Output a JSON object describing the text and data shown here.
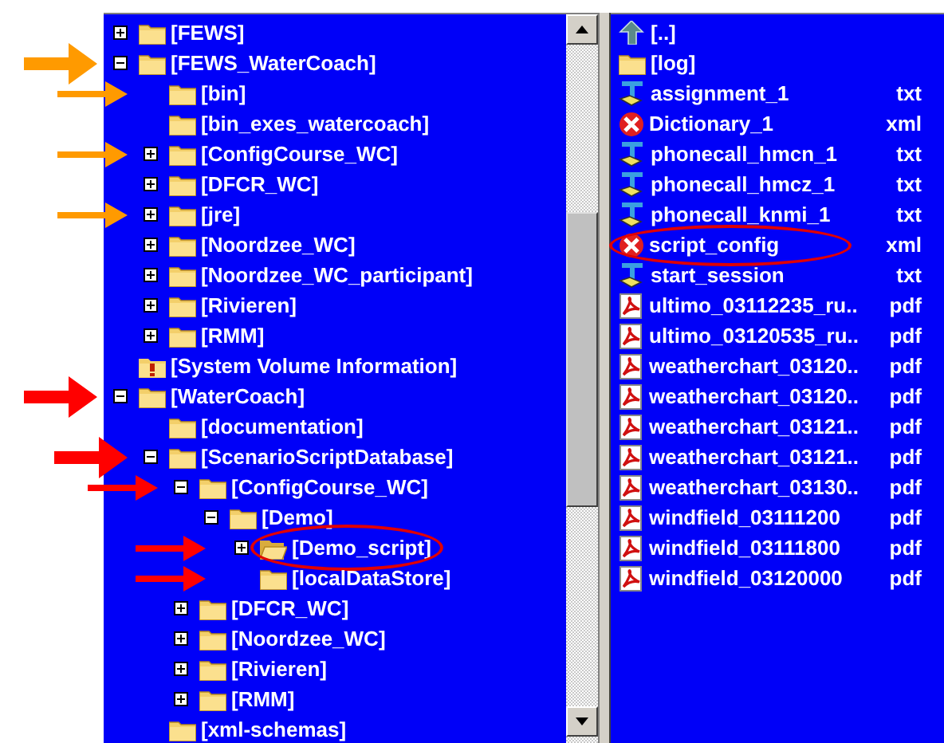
{
  "tree": [
    {
      "label": "[FEWS]",
      "kind": "folder",
      "expanded": false
    },
    {
      "label": "[FEWS_WaterCoach]",
      "kind": "folder",
      "expanded": true,
      "arrow": {
        "color": "#ff9a00",
        "kind": "large"
      },
      "children": [
        {
          "label": "[bin]",
          "kind": "folder",
          "arrow": {
            "color": "#ff9a00",
            "kind": "small"
          }
        },
        {
          "label": "[bin_exes_watercoach]",
          "kind": "folder"
        },
        {
          "label": "[ConfigCourse_WC]",
          "kind": "folder",
          "expanded": false,
          "arrow": {
            "color": "#ff9a00",
            "kind": "small"
          }
        },
        {
          "label": "[DFCR_WC]",
          "kind": "folder",
          "expanded": false
        },
        {
          "label": "[jre]",
          "kind": "folder",
          "expanded": false,
          "arrow": {
            "color": "#ff9a00",
            "kind": "small"
          }
        },
        {
          "label": "[Noordzee_WC]",
          "kind": "folder",
          "expanded": false
        },
        {
          "label": "[Noordzee_WC_participant]",
          "kind": "folder",
          "expanded": false
        },
        {
          "label": "[Rivieren]",
          "kind": "folder",
          "expanded": false
        },
        {
          "label": "[RMM]",
          "kind": "folder",
          "expanded": false
        }
      ]
    },
    {
      "label": "[System Volume Information]",
      "kind": "warning-folder"
    },
    {
      "label": "[WaterCoach]",
      "kind": "folder",
      "expanded": true,
      "arrow": {
        "color": "#ff0000",
        "kind": "large"
      },
      "children": [
        {
          "label": "[documentation]",
          "kind": "folder"
        },
        {
          "label": "[ScenarioScriptDatabase]",
          "kind": "folder",
          "expanded": true,
          "arrow": {
            "color": "#ff0000",
            "kind": "large"
          },
          "children": [
            {
              "label": "[ConfigCourse_WC]",
              "kind": "folder",
              "expanded": true,
              "arrow": {
                "color": "#ff0000",
                "kind": "small"
              },
              "children": [
                {
                  "label": "[Demo]",
                  "kind": "folder",
                  "expanded": true,
                  "children": [
                    {
                      "label": "[Demo_script]",
                      "kind": "open-folder",
                      "expanded": false,
                      "circled": true,
                      "arrow": {
                        "color": "#ff0000",
                        "kind": "small"
                      }
                    },
                    {
                      "label": "[localDataStore]",
                      "kind": "folder",
                      "arrow": {
                        "color": "#ff0000",
                        "kind": "small"
                      }
                    }
                  ]
                }
              ]
            },
            {
              "label": "[DFCR_WC]",
              "kind": "folder",
              "expanded": false
            },
            {
              "label": "[Noordzee_WC]",
              "kind": "folder",
              "expanded": false
            },
            {
              "label": "[Rivieren]",
              "kind": "folder",
              "expanded": false
            },
            {
              "label": "[RMM]",
              "kind": "folder",
              "expanded": false
            }
          ]
        },
        {
          "label": "[xml-schemas]",
          "kind": "folder"
        }
      ]
    }
  ],
  "files": [
    {
      "name": "[..]",
      "kind": "up"
    },
    {
      "name": "[log]",
      "kind": "folder"
    },
    {
      "name": "assignment_1",
      "ext": "txt",
      "kind": "text"
    },
    {
      "name": "Dictionary_1",
      "ext": "xml",
      "kind": "xml"
    },
    {
      "name": "phonecall_hmcn_1",
      "ext": "txt",
      "kind": "text"
    },
    {
      "name": "phonecall_hmcz_1",
      "ext": "txt",
      "kind": "text"
    },
    {
      "name": "phonecall_knmi_1",
      "ext": "txt",
      "kind": "text"
    },
    {
      "name": "script_config",
      "ext": "xml",
      "kind": "xml",
      "circled": true
    },
    {
      "name": "start_session",
      "ext": "txt",
      "kind": "text"
    },
    {
      "name": "ultimo_03112235_ru..",
      "ext": "pdf",
      "kind": "pdf"
    },
    {
      "name": "ultimo_03120535_ru..",
      "ext": "pdf",
      "kind": "pdf"
    },
    {
      "name": "weatherchart_03120..",
      "ext": "pdf",
      "kind": "pdf"
    },
    {
      "name": "weatherchart_03120..",
      "ext": "pdf",
      "kind": "pdf"
    },
    {
      "name": "weatherchart_03121..",
      "ext": "pdf",
      "kind": "pdf"
    },
    {
      "name": "weatherchart_03121..",
      "ext": "pdf",
      "kind": "pdf"
    },
    {
      "name": "weatherchart_03130..",
      "ext": "pdf",
      "kind": "pdf"
    },
    {
      "name": "windfield_03111200",
      "ext": "pdf",
      "kind": "pdf"
    },
    {
      "name": "windfield_03111800",
      "ext": "pdf",
      "kind": "pdf"
    },
    {
      "name": "windfield_03120000",
      "ext": "pdf",
      "kind": "pdf"
    }
  ]
}
